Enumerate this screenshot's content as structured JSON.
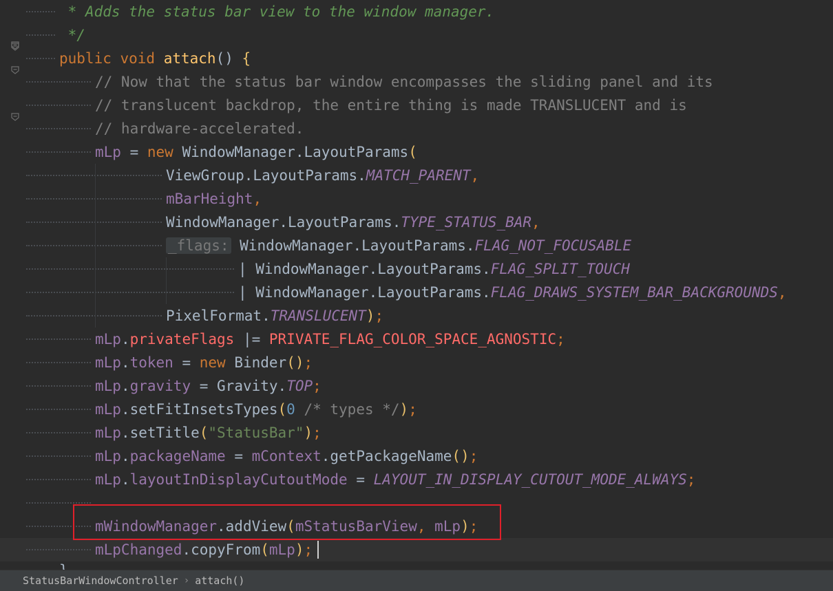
{
  "editor": {
    "lines": [
      {
        "tokens": [
          {
            "cls": "t-doc",
            "text": " * Adds the status bar view to the window manager."
          }
        ]
      },
      {
        "tokens": [
          {
            "cls": "t-doc",
            "text": " */"
          }
        ]
      },
      {
        "tokens": [
          {
            "cls": "t-kw",
            "text": "public void "
          },
          {
            "cls": "t-method",
            "text": "attach"
          },
          {
            "cls": "t-text",
            "text": "() "
          },
          {
            "cls": "t-paren",
            "text": "{"
          }
        ]
      },
      {
        "tokens": [
          {
            "cls": "t-comment",
            "text": "// Now that the status bar window encompasses the sliding panel and its"
          }
        ]
      },
      {
        "tokens": [
          {
            "cls": "t-comment",
            "text": "// translucent backdrop, the entire thing is made TRANSLUCENT and is"
          }
        ]
      },
      {
        "tokens": [
          {
            "cls": "t-comment",
            "text": "// hardware-accelerated."
          }
        ]
      },
      {
        "tokens": [
          {
            "cls": "t-field",
            "text": "mLp"
          },
          {
            "cls": "t-text",
            "text": " = "
          },
          {
            "cls": "t-kw",
            "text": "new "
          },
          {
            "cls": "t-text",
            "text": "WindowManager.LayoutParams"
          },
          {
            "cls": "t-paren",
            "text": "("
          }
        ]
      },
      {
        "tokens": [
          {
            "cls": "t-text",
            "text": "ViewGroup.LayoutParams."
          },
          {
            "cls": "t-const",
            "text": "MATCH_PARENT"
          },
          {
            "cls": "t-kw",
            "text": ","
          }
        ]
      },
      {
        "tokens": [
          {
            "cls": "t-field",
            "text": "mBarHeight"
          },
          {
            "cls": "t-kw",
            "text": ","
          }
        ]
      },
      {
        "tokens": [
          {
            "cls": "t-text",
            "text": "WindowManager.LayoutParams."
          },
          {
            "cls": "t-const",
            "text": "TYPE_STATUS_BAR"
          },
          {
            "cls": "t-kw",
            "text": ","
          }
        ]
      },
      {
        "tokens": [
          {
            "cls": "hint",
            "text": "_flags:"
          },
          {
            "cls": "t-text",
            "text": " WindowManager.LayoutParams."
          },
          {
            "cls": "t-const",
            "text": "FLAG_NOT_FOCUSABLE"
          }
        ]
      },
      {
        "tokens": [
          {
            "cls": "t-text",
            "text": "| WindowManager.LayoutParams."
          },
          {
            "cls": "t-const",
            "text": "FLAG_SPLIT_TOUCH"
          }
        ]
      },
      {
        "tokens": [
          {
            "cls": "t-text",
            "text": "| WindowManager.LayoutParams."
          },
          {
            "cls": "t-const",
            "text": "FLAG_DRAWS_SYSTEM_BAR_BACKGROUNDS"
          },
          {
            "cls": "t-kw",
            "text": ","
          }
        ]
      },
      {
        "tokens": [
          {
            "cls": "t-text",
            "text": "PixelFormat."
          },
          {
            "cls": "t-const",
            "text": "TRANSLUCENT"
          },
          {
            "cls": "t-paren",
            "text": ")"
          },
          {
            "cls": "t-kw",
            "text": ";"
          }
        ]
      },
      {
        "tokens": [
          {
            "cls": "t-field",
            "text": "mLp"
          },
          {
            "cls": "t-text",
            "text": "."
          },
          {
            "cls": "t-err",
            "text": "privateFlags"
          },
          {
            "cls": "t-text",
            "text": " |= "
          },
          {
            "cls": "t-err",
            "text": "PRIVATE_FLAG_COLOR_SPACE_AGNOSTIC"
          },
          {
            "cls": "t-kw",
            "text": ";"
          }
        ]
      },
      {
        "tokens": [
          {
            "cls": "t-field",
            "text": "mLp"
          },
          {
            "cls": "t-text",
            "text": "."
          },
          {
            "cls": "t-field",
            "text": "token"
          },
          {
            "cls": "t-text",
            "text": " = "
          },
          {
            "cls": "t-kw",
            "text": "new "
          },
          {
            "cls": "t-text",
            "text": "Binder"
          },
          {
            "cls": "t-paren",
            "text": "()"
          },
          {
            "cls": "t-kw",
            "text": ";"
          }
        ]
      },
      {
        "tokens": [
          {
            "cls": "t-field",
            "text": "mLp"
          },
          {
            "cls": "t-text",
            "text": "."
          },
          {
            "cls": "t-field",
            "text": "gravity"
          },
          {
            "cls": "t-text",
            "text": " = Gravity."
          },
          {
            "cls": "t-const",
            "text": "TOP"
          },
          {
            "cls": "t-kw",
            "text": ";"
          }
        ]
      },
      {
        "tokens": [
          {
            "cls": "t-field",
            "text": "mLp"
          },
          {
            "cls": "t-text",
            "text": ".setFitInsetsTypes"
          },
          {
            "cls": "t-paren",
            "text": "("
          },
          {
            "cls": "t-num",
            "text": "0"
          },
          {
            "cls": "t-comment",
            "text": " /* types */"
          },
          {
            "cls": "t-paren",
            "text": ")"
          },
          {
            "cls": "t-kw",
            "text": ";"
          }
        ]
      },
      {
        "tokens": [
          {
            "cls": "t-field",
            "text": "mLp"
          },
          {
            "cls": "t-text",
            "text": ".setTitle"
          },
          {
            "cls": "t-paren",
            "text": "("
          },
          {
            "cls": "t-str",
            "text": "\"StatusBar\""
          },
          {
            "cls": "t-paren",
            "text": ")"
          },
          {
            "cls": "t-kw",
            "text": ";"
          }
        ]
      },
      {
        "tokens": [
          {
            "cls": "t-field",
            "text": "mLp"
          },
          {
            "cls": "t-text",
            "text": "."
          },
          {
            "cls": "t-field",
            "text": "packageName"
          },
          {
            "cls": "t-text",
            "text": " = "
          },
          {
            "cls": "t-field",
            "text": "mContext"
          },
          {
            "cls": "t-text",
            "text": ".getPackageName"
          },
          {
            "cls": "t-paren",
            "text": "()"
          },
          {
            "cls": "t-kw",
            "text": ";"
          }
        ]
      },
      {
        "tokens": [
          {
            "cls": "t-field",
            "text": "mLp"
          },
          {
            "cls": "t-text",
            "text": "."
          },
          {
            "cls": "t-field",
            "text": "layoutInDisplayCutoutMode"
          },
          {
            "cls": "t-text",
            "text": " = "
          },
          {
            "cls": "t-const",
            "text": "LAYOUT_IN_DISPLAY_CUTOUT_MODE_ALWAYS"
          },
          {
            "cls": "t-kw",
            "text": ";"
          }
        ]
      },
      {
        "tokens": []
      },
      {
        "tokens": [
          {
            "cls": "t-field",
            "text": "mWindowManager"
          },
          {
            "cls": "t-text",
            "text": ".addView"
          },
          {
            "cls": "t-paren",
            "text": "("
          },
          {
            "cls": "t-field",
            "text": "mStatusBarView"
          },
          {
            "cls": "t-kw",
            "text": ", "
          },
          {
            "cls": "t-field",
            "text": "mLp"
          },
          {
            "cls": "t-paren",
            "text": ")"
          },
          {
            "cls": "t-kw",
            "text": ";"
          }
        ]
      },
      {
        "tokens": [
          {
            "cls": "t-field",
            "text": "mLpChanged"
          },
          {
            "cls": "t-text",
            "text": ".copyFrom"
          },
          {
            "cls": "t-paren",
            "text": "("
          },
          {
            "cls": "t-field",
            "text": "mLp"
          },
          {
            "cls": "t-paren",
            "text": ")"
          },
          {
            "cls": "t-kw",
            "text": ";"
          }
        ]
      }
    ],
    "closing_brace": "}"
  },
  "breadcrumb": {
    "class_name": "StatusBarWindowController",
    "method_name": "attach()"
  },
  "colors": {
    "background": "#2b2b2b",
    "highlight_box": "#e0202a",
    "keyword": "#cc7832",
    "method": "#ffc66d",
    "field": "#9876aa",
    "doc_comment": "#629755",
    "error": "#ff6b68"
  }
}
